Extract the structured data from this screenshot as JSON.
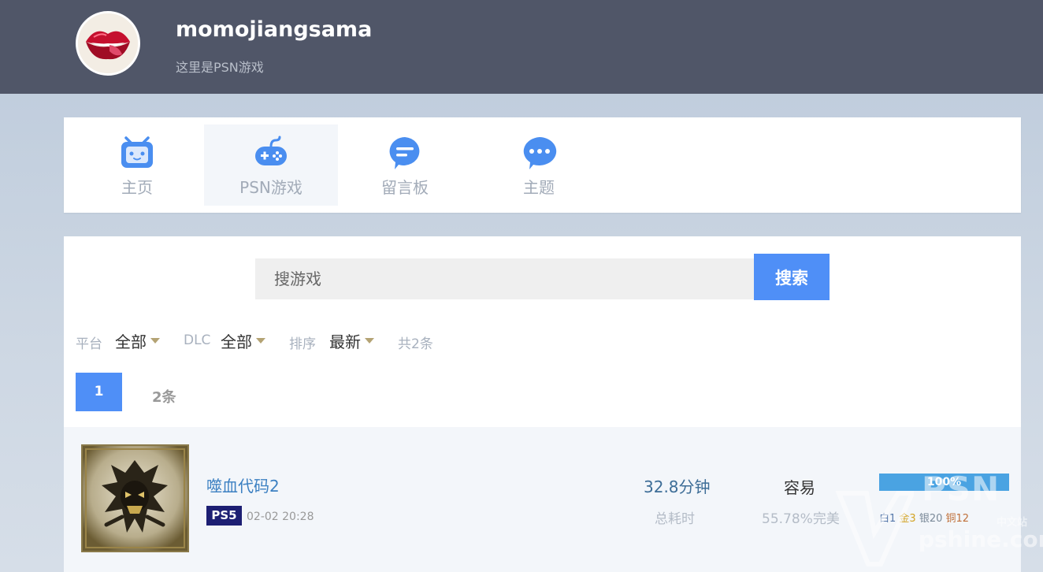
{
  "profile": {
    "username": "momojiangsama",
    "subtitle": "这里是PSN游戏"
  },
  "nav": {
    "items": [
      {
        "label": "主页",
        "icon": "tv-icon"
      },
      {
        "label": "PSN游戏",
        "icon": "gamepad-icon",
        "active": true
      },
      {
        "label": "留言板",
        "icon": "message-icon"
      },
      {
        "label": "主题",
        "icon": "chat-dots-icon"
      }
    ]
  },
  "search": {
    "placeholder": "搜游戏",
    "button_label": "搜索"
  },
  "filters": {
    "platform_label": "平台",
    "platform_value": "全部",
    "dlc_label": "DLC",
    "dlc_value": "全部",
    "sort_label": "排序",
    "sort_value": "最新",
    "total": "共2条"
  },
  "pagination": {
    "current_page": "1",
    "count_label": "2条"
  },
  "games": [
    {
      "title": "噬血代码2",
      "platform": "PS5",
      "date": "02-02 20:28",
      "playtime": "32.8分钟",
      "playtime_label": "总耗时",
      "difficulty": "容易",
      "completion": "55.78%完美",
      "progress": 100,
      "progress_text": "100%",
      "trophies": {
        "platinum": "白1",
        "gold": "金3",
        "silver": "银20",
        "bronze": "铜12"
      }
    }
  ],
  "watermark": {
    "brand": "PSN",
    "sub": "中文站",
    "domain": "pshine.com"
  },
  "colors": {
    "header_bg": "#505668",
    "accent": "#4f8ff7",
    "progress": "#4aa3e2",
    "ps5_badge": "#1d1f73",
    "link": "#3c80c2"
  }
}
